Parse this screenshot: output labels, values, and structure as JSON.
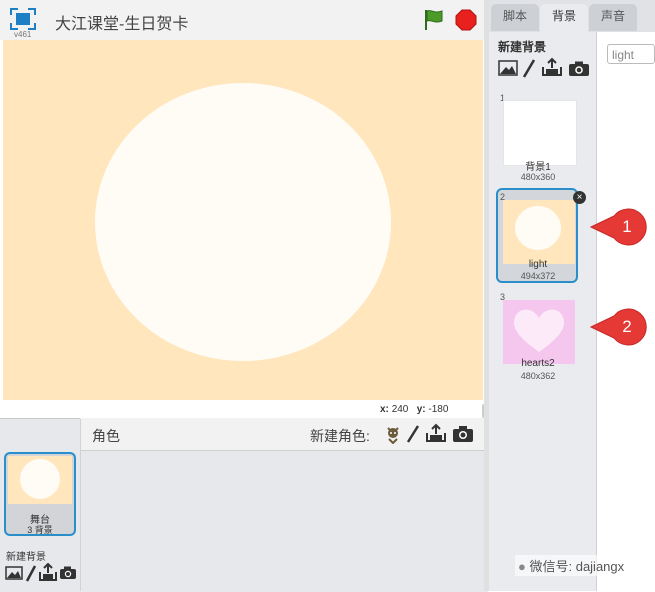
{
  "header": {
    "version": "v461",
    "title": "大江课堂-生日贺卡"
  },
  "stage": {
    "x_label": "x:",
    "x_value": "240",
    "y_label": "y:",
    "y_value": "-180",
    "background_color": "#ffe6bd",
    "circle_color": "#fffcf6"
  },
  "sprites": {
    "label": "角色",
    "new_sprite_label": "新建角色:"
  },
  "stage_thumb": {
    "name": "舞台",
    "backdrop_count": "3 背景"
  },
  "new_backdrop_left": "新建背景",
  "tabs": [
    {
      "label": "脚本"
    },
    {
      "label": "背景"
    },
    {
      "label": "声音"
    }
  ],
  "backdrops_panel": {
    "title": "新建背景",
    "items": [
      {
        "num": "1",
        "name": "背景1",
        "size": "480x360"
      },
      {
        "num": "2",
        "name": "light",
        "size": "494x372"
      },
      {
        "num": "3",
        "name": "hearts2",
        "size": "480x362"
      }
    ]
  },
  "name_field": {
    "value": "light"
  },
  "callouts": [
    "1",
    "2"
  ],
  "watermark": "微信号: dajiangx",
  "colors": {
    "accent": "#2a8fc9",
    "callout": "#e53935",
    "flag": "#4c9a2a",
    "stop": "#e8211e"
  }
}
